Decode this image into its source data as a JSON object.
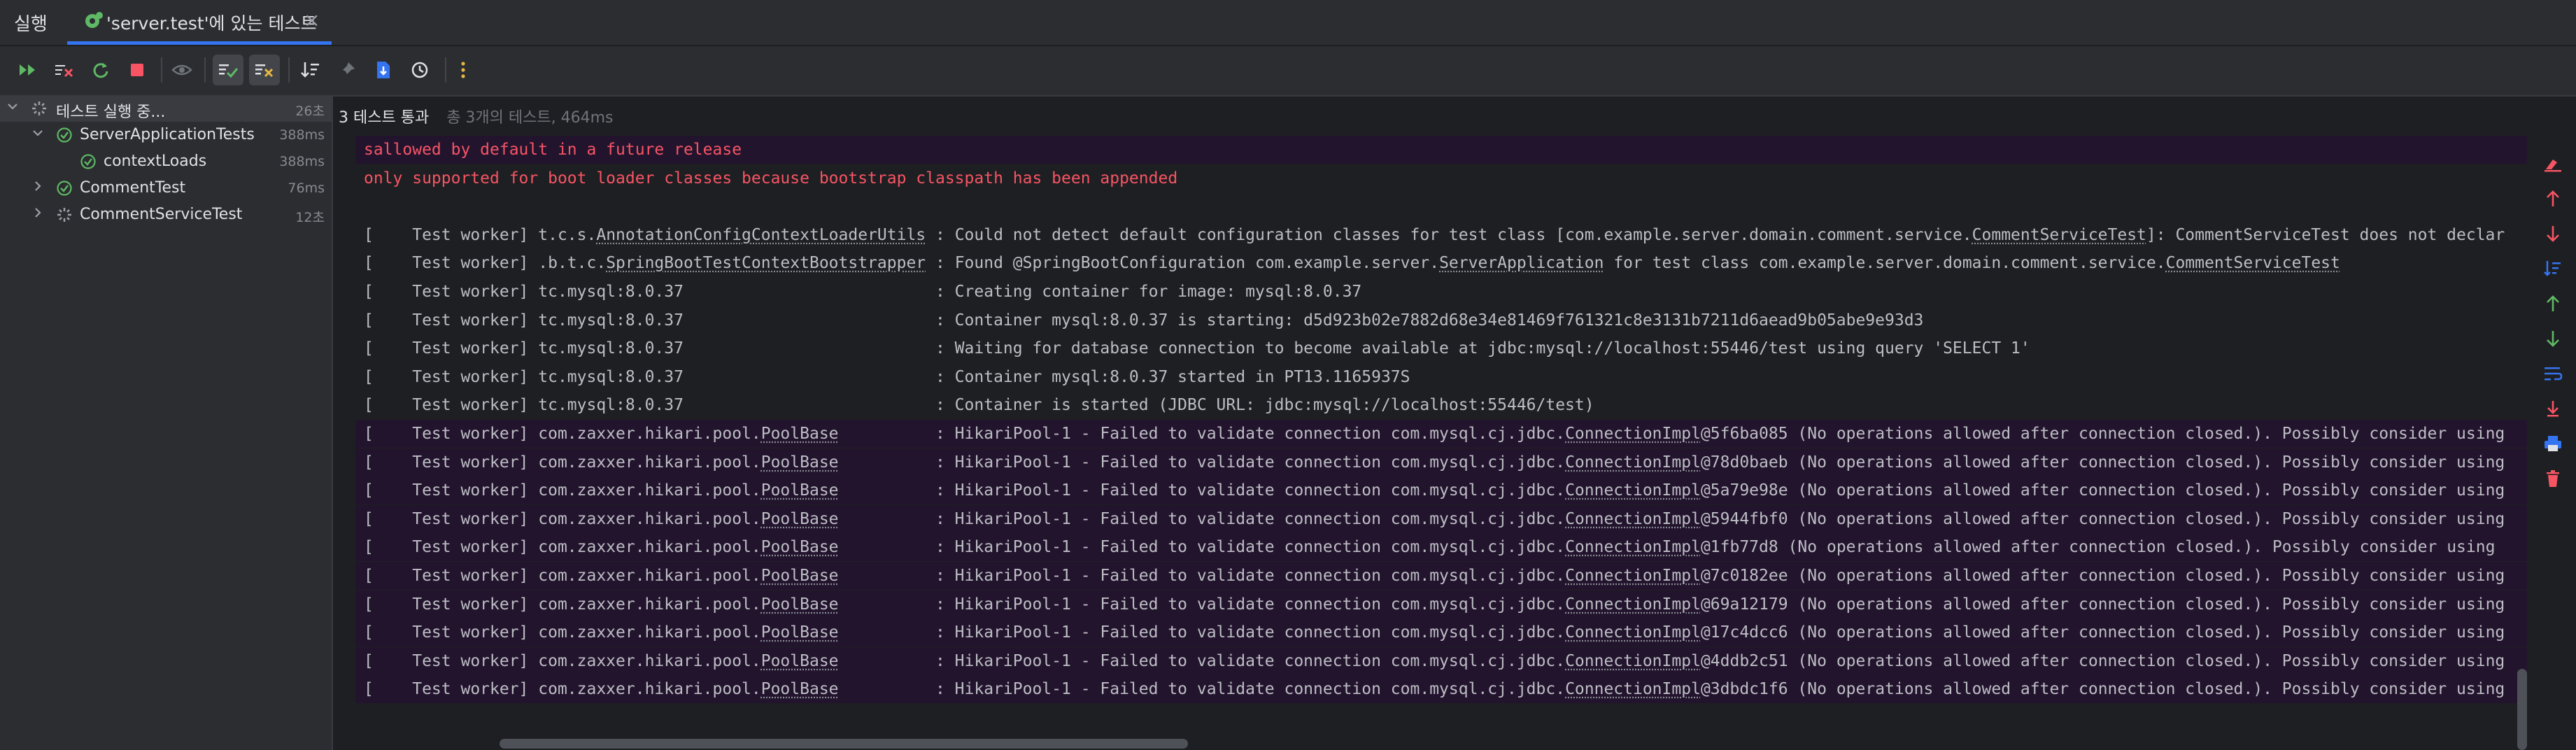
{
  "run_panel": {
    "title": "실행"
  },
  "tab": {
    "label": "'server.test'에 있는 테스트",
    "close": "×"
  },
  "toolbar": {
    "buttons": [
      "rerun-failed-icon",
      "stop-rerun-icon",
      "rerun-icon",
      "stop-icon",
      "eye-icon",
      "show-passed-icon",
      "show-ignored-icon",
      "sort-icon",
      "pin-icon",
      "export-icon",
      "history-icon",
      "more-icon"
    ]
  },
  "tree": {
    "items": [
      {
        "name": "테스트 실행 중...",
        "time": "26초",
        "status": "running"
      },
      {
        "name": "ServerApplicationTests",
        "time": "388ms",
        "status": "passed"
      },
      {
        "name": "contextLoads",
        "time": "388ms",
        "status": "passed"
      },
      {
        "name": "CommentTest",
        "time": "76ms",
        "status": "passed"
      },
      {
        "name": "CommentServiceTest",
        "time": "12초",
        "status": "running"
      }
    ]
  },
  "status": {
    "passed": "3 테스트 통과",
    "meta": "총 3개의 테스트, 464ms"
  },
  "console": {
    "lines": [
      {
        "text": "sallowed by default in a future release",
        "style": "err-hl"
      },
      {
        "text": "only supported for boot loader classes because bootstrap classpath has been appended",
        "style": "err"
      },
      {
        "text": "",
        "style": "plain"
      },
      {
        "prefix": "[    Test worker] t.c.s.",
        "u1": "AnnotationConfigContextLoaderUtils",
        "mid": " : Could not detect default configuration classes for test class [com.example.server.domain.comment.service.",
        "u2": "CommentServiceTest",
        "suffix": "]: CommentServiceTest does not declar",
        "style": "plain"
      },
      {
        "prefix": "[    Test worker] .b.t.c.",
        "u1": "SpringBootTestContextBootstrapper",
        "mid": " : Found @SpringBootConfiguration com.example.server.",
        "u2": "ServerApplication",
        "suffix": " for test class com.example.server.domain.comment.service.",
        "u3": "CommentServiceTest",
        "style": "plain"
      },
      {
        "text": "[    Test worker] tc.mysql:8.0.37                          : Creating container for image: mysql:8.0.37",
        "style": "plain"
      },
      {
        "text": "[    Test worker] tc.mysql:8.0.37                          : Container mysql:8.0.37 is starting: d5d923b02e7882d68e34e81469f761321c8e3131b7211d6aead9b05abe9e93d3",
        "style": "plain"
      },
      {
        "text": "[    Test worker] tc.mysql:8.0.37                          : Waiting for database connection to become available at jdbc:mysql://localhost:55446/test using query 'SELECT 1'",
        "style": "plain"
      },
      {
        "text": "[    Test worker] tc.mysql:8.0.37                          : Container mysql:8.0.37 started in PT13.1165937S",
        "style": "plain"
      },
      {
        "text": "[    Test worker] tc.mysql:8.0.37                          : Container is started (JDBC URL: jdbc:mysql://localhost:55446/test)",
        "style": "plain"
      },
      {
        "pool": true,
        "conn": "5f6ba085",
        "tail": " (No operations allowed after connection closed.). Possibly consider using"
      },
      {
        "pool": true,
        "conn": "78d0baeb",
        "tail": " (No operations allowed after connection closed.). Possibly consider using"
      },
      {
        "pool": true,
        "conn": "5a79e98e",
        "tail": " (No operations allowed after connection closed.). Possibly consider using"
      },
      {
        "pool": true,
        "conn": "5944fbf0",
        "tail": " (No operations allowed after connection closed.). Possibly consider using"
      },
      {
        "pool": true,
        "conn": "1fb77d8",
        "tail": " (No operations allowed after connection closed.). Possibly consider using"
      },
      {
        "pool": true,
        "conn": "7c0182ee",
        "tail": " (No operations allowed after connection closed.). Possibly consider using"
      },
      {
        "pool": true,
        "conn": "69a12179",
        "tail": " (No operations allowed after connection closed.). Possibly consider using"
      },
      {
        "pool": true,
        "conn": "17c4dcc6",
        "tail": " (No operations allowed after connection closed.). Possibly consider using"
      },
      {
        "pool": true,
        "conn": "4ddb2c51",
        "tail": " (No operations allowed after connection closed.). Possibly consider using"
      },
      {
        "pool": true,
        "conn": "3dbdc1f6",
        "tail": " (No operations allowed after connection closed.). Possibly consider using"
      }
    ],
    "pool_prefix": "[    Test worker] com.zaxxer.hikari.pool.",
    "pool_class": "PoolBase",
    "pool_mid": "          : HikariPool-1 - Failed to validate connection com.mysql.cj.jdbc.",
    "pool_impl": "ConnectionImpl",
    "pool_at": "@"
  },
  "right_toolbar": {
    "buttons": [
      "clear-icon",
      "prev-failed-icon",
      "next-failed-icon",
      "sort-output-icon",
      "scroll-up-icon",
      "scroll-down-icon",
      "soft-wrap-icon",
      "scroll-to-end-icon",
      "print-icon",
      "delete-icon"
    ]
  },
  "colors": {
    "accent": "#3574f0",
    "pass": "#5fb865",
    "error": "#f75464",
    "highlight_bg": "#23142e"
  }
}
